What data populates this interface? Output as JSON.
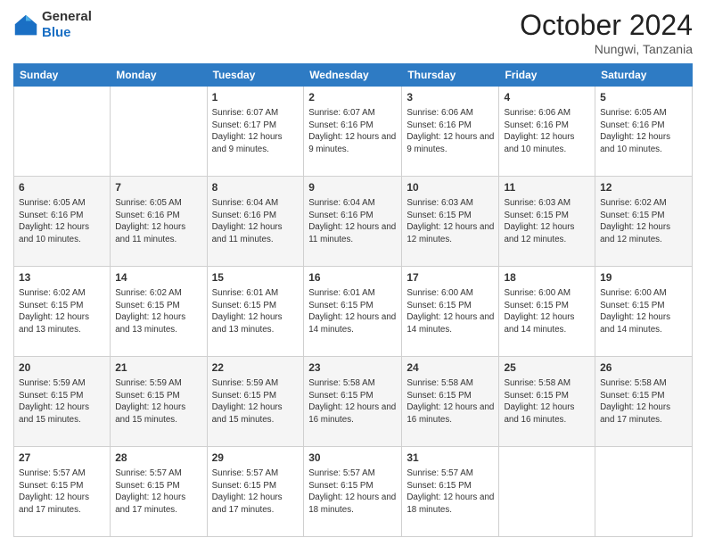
{
  "header": {
    "logo_general": "General",
    "logo_blue": "Blue",
    "month_title": "October 2024",
    "location": "Nungwi, Tanzania"
  },
  "days_of_week": [
    "Sunday",
    "Monday",
    "Tuesday",
    "Wednesday",
    "Thursday",
    "Friday",
    "Saturday"
  ],
  "weeks": [
    [
      {
        "day": "",
        "sunrise": "",
        "sunset": "",
        "daylight": ""
      },
      {
        "day": "",
        "sunrise": "",
        "sunset": "",
        "daylight": ""
      },
      {
        "day": "1",
        "sunrise": "Sunrise: 6:07 AM",
        "sunset": "Sunset: 6:17 PM",
        "daylight": "Daylight: 12 hours and 9 minutes."
      },
      {
        "day": "2",
        "sunrise": "Sunrise: 6:07 AM",
        "sunset": "Sunset: 6:16 PM",
        "daylight": "Daylight: 12 hours and 9 minutes."
      },
      {
        "day": "3",
        "sunrise": "Sunrise: 6:06 AM",
        "sunset": "Sunset: 6:16 PM",
        "daylight": "Daylight: 12 hours and 9 minutes."
      },
      {
        "day": "4",
        "sunrise": "Sunrise: 6:06 AM",
        "sunset": "Sunset: 6:16 PM",
        "daylight": "Daylight: 12 hours and 10 minutes."
      },
      {
        "day": "5",
        "sunrise": "Sunrise: 6:05 AM",
        "sunset": "Sunset: 6:16 PM",
        "daylight": "Daylight: 12 hours and 10 minutes."
      }
    ],
    [
      {
        "day": "6",
        "sunrise": "Sunrise: 6:05 AM",
        "sunset": "Sunset: 6:16 PM",
        "daylight": "Daylight: 12 hours and 10 minutes."
      },
      {
        "day": "7",
        "sunrise": "Sunrise: 6:05 AM",
        "sunset": "Sunset: 6:16 PM",
        "daylight": "Daylight: 12 hours and 11 minutes."
      },
      {
        "day": "8",
        "sunrise": "Sunrise: 6:04 AM",
        "sunset": "Sunset: 6:16 PM",
        "daylight": "Daylight: 12 hours and 11 minutes."
      },
      {
        "day": "9",
        "sunrise": "Sunrise: 6:04 AM",
        "sunset": "Sunset: 6:16 PM",
        "daylight": "Daylight: 12 hours and 11 minutes."
      },
      {
        "day": "10",
        "sunrise": "Sunrise: 6:03 AM",
        "sunset": "Sunset: 6:15 PM",
        "daylight": "Daylight: 12 hours and 12 minutes."
      },
      {
        "day": "11",
        "sunrise": "Sunrise: 6:03 AM",
        "sunset": "Sunset: 6:15 PM",
        "daylight": "Daylight: 12 hours and 12 minutes."
      },
      {
        "day": "12",
        "sunrise": "Sunrise: 6:02 AM",
        "sunset": "Sunset: 6:15 PM",
        "daylight": "Daylight: 12 hours and 12 minutes."
      }
    ],
    [
      {
        "day": "13",
        "sunrise": "Sunrise: 6:02 AM",
        "sunset": "Sunset: 6:15 PM",
        "daylight": "Daylight: 12 hours and 13 minutes."
      },
      {
        "day": "14",
        "sunrise": "Sunrise: 6:02 AM",
        "sunset": "Sunset: 6:15 PM",
        "daylight": "Daylight: 12 hours and 13 minutes."
      },
      {
        "day": "15",
        "sunrise": "Sunrise: 6:01 AM",
        "sunset": "Sunset: 6:15 PM",
        "daylight": "Daylight: 12 hours and 13 minutes."
      },
      {
        "day": "16",
        "sunrise": "Sunrise: 6:01 AM",
        "sunset": "Sunset: 6:15 PM",
        "daylight": "Daylight: 12 hours and 14 minutes."
      },
      {
        "day": "17",
        "sunrise": "Sunrise: 6:00 AM",
        "sunset": "Sunset: 6:15 PM",
        "daylight": "Daylight: 12 hours and 14 minutes."
      },
      {
        "day": "18",
        "sunrise": "Sunrise: 6:00 AM",
        "sunset": "Sunset: 6:15 PM",
        "daylight": "Daylight: 12 hours and 14 minutes."
      },
      {
        "day": "19",
        "sunrise": "Sunrise: 6:00 AM",
        "sunset": "Sunset: 6:15 PM",
        "daylight": "Daylight: 12 hours and 14 minutes."
      }
    ],
    [
      {
        "day": "20",
        "sunrise": "Sunrise: 5:59 AM",
        "sunset": "Sunset: 6:15 PM",
        "daylight": "Daylight: 12 hours and 15 minutes."
      },
      {
        "day": "21",
        "sunrise": "Sunrise: 5:59 AM",
        "sunset": "Sunset: 6:15 PM",
        "daylight": "Daylight: 12 hours and 15 minutes."
      },
      {
        "day": "22",
        "sunrise": "Sunrise: 5:59 AM",
        "sunset": "Sunset: 6:15 PM",
        "daylight": "Daylight: 12 hours and 15 minutes."
      },
      {
        "day": "23",
        "sunrise": "Sunrise: 5:58 AM",
        "sunset": "Sunset: 6:15 PM",
        "daylight": "Daylight: 12 hours and 16 minutes."
      },
      {
        "day": "24",
        "sunrise": "Sunrise: 5:58 AM",
        "sunset": "Sunset: 6:15 PM",
        "daylight": "Daylight: 12 hours and 16 minutes."
      },
      {
        "day": "25",
        "sunrise": "Sunrise: 5:58 AM",
        "sunset": "Sunset: 6:15 PM",
        "daylight": "Daylight: 12 hours and 16 minutes."
      },
      {
        "day": "26",
        "sunrise": "Sunrise: 5:58 AM",
        "sunset": "Sunset: 6:15 PM",
        "daylight": "Daylight: 12 hours and 17 minutes."
      }
    ],
    [
      {
        "day": "27",
        "sunrise": "Sunrise: 5:57 AM",
        "sunset": "Sunset: 6:15 PM",
        "daylight": "Daylight: 12 hours and 17 minutes."
      },
      {
        "day": "28",
        "sunrise": "Sunrise: 5:57 AM",
        "sunset": "Sunset: 6:15 PM",
        "daylight": "Daylight: 12 hours and 17 minutes."
      },
      {
        "day": "29",
        "sunrise": "Sunrise: 5:57 AM",
        "sunset": "Sunset: 6:15 PM",
        "daylight": "Daylight: 12 hours and 17 minutes."
      },
      {
        "day": "30",
        "sunrise": "Sunrise: 5:57 AM",
        "sunset": "Sunset: 6:15 PM",
        "daylight": "Daylight: 12 hours and 18 minutes."
      },
      {
        "day": "31",
        "sunrise": "Sunrise: 5:57 AM",
        "sunset": "Sunset: 6:15 PM",
        "daylight": "Daylight: 12 hours and 18 minutes."
      },
      {
        "day": "",
        "sunrise": "",
        "sunset": "",
        "daylight": ""
      },
      {
        "day": "",
        "sunrise": "",
        "sunset": "",
        "daylight": ""
      }
    ]
  ]
}
